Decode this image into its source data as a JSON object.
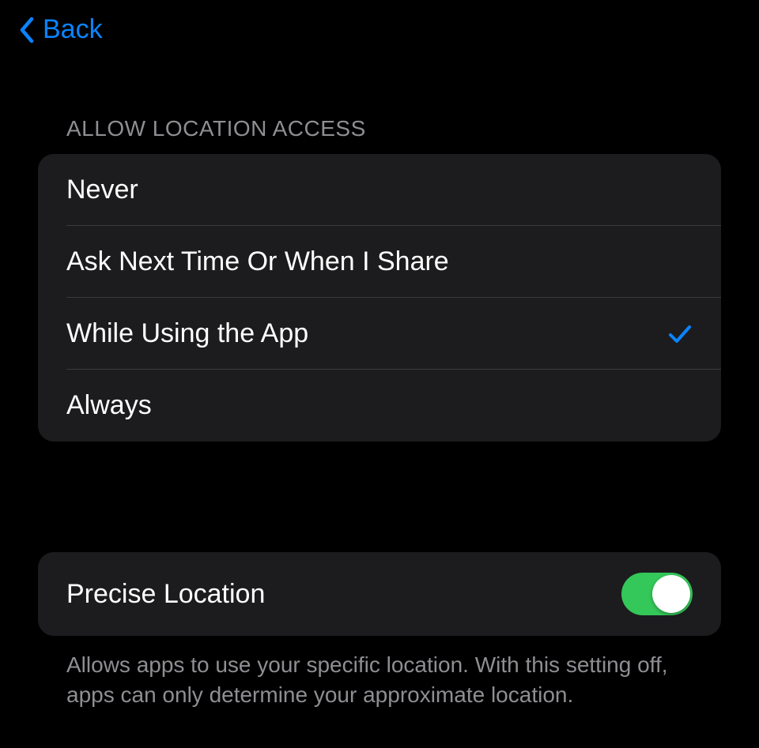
{
  "nav": {
    "back_label": "Back"
  },
  "location_access": {
    "header": "Allow Location Access",
    "options": [
      {
        "label": "Never",
        "selected": false
      },
      {
        "label": "Ask Next Time Or When I Share",
        "selected": false
      },
      {
        "label": "While Using the App",
        "selected": true
      },
      {
        "label": "Always",
        "selected": false
      }
    ]
  },
  "precise_location": {
    "label": "Precise Location",
    "enabled": true,
    "footer": "Allows apps to use your specific location. With this setting off, apps can only determine your approximate location."
  },
  "colors": {
    "accent": "#0a84ff",
    "toggle_on": "#34c759"
  }
}
